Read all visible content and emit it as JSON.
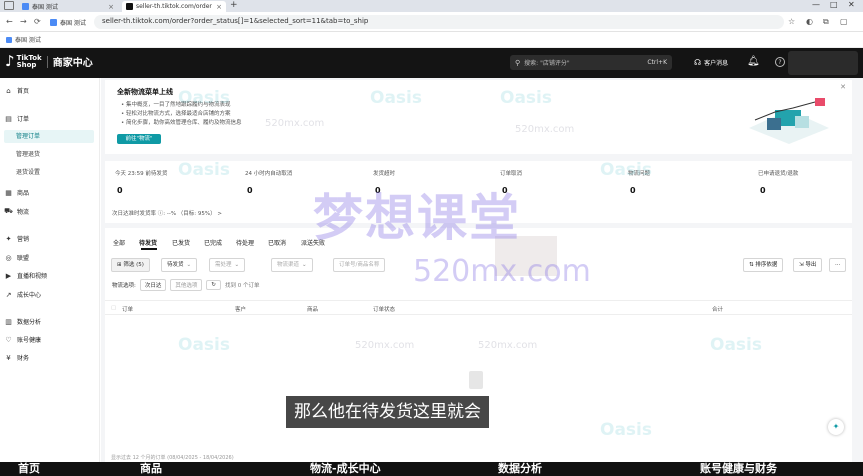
{
  "browser": {
    "tabs": [
      {
        "title": "泰国 测试",
        "color": "#4c8bf5"
      },
      {
        "title": "seller-th.tiktok.com/order",
        "color": "#111111"
      }
    ],
    "new_tab": "+",
    "window_controls": [
      "—",
      "□",
      "✕"
    ],
    "nav": {
      "back": "←",
      "forward": "→",
      "reload": "⟳"
    },
    "bookmark_chip": "泰国 测试",
    "url": "seller-th.tiktok.com/order?order_status[]=1&selected_sort=11&tab=to_ship",
    "toolbar_icons": [
      "☆",
      "◐",
      "⧉",
      "▢"
    ],
    "bookmarks": [
      {
        "label": "泰国 测试"
      }
    ]
  },
  "header": {
    "logo_note": "♪",
    "logo_line1": "TikTok",
    "logo_line2": "Shop",
    "center": "商家中心",
    "search_placeholder": "搜索: \"店铺评分\"",
    "search_shortcut": "Ctrl+K",
    "customer_service": "客户消息"
  },
  "sidebar": {
    "items": [
      {
        "icon": "⌂",
        "label": "首页"
      },
      {
        "icon": "▤",
        "label": "订单"
      },
      {
        "icon": "▦",
        "label": "商品"
      },
      {
        "icon": "⛟",
        "label": "物流"
      },
      {
        "icon": "✦",
        "label": "营销"
      },
      {
        "icon": "◎",
        "label": "联盟"
      },
      {
        "icon": "▶",
        "label": "直播和视频"
      },
      {
        "icon": "↗",
        "label": "成长中心"
      },
      {
        "icon": "▥",
        "label": "数据分析"
      },
      {
        "icon": "♡",
        "label": "账号健康"
      },
      {
        "icon": "¥",
        "label": "财务"
      }
    ],
    "order_sub": [
      "管理订单",
      "管理退货",
      "退货设置"
    ]
  },
  "banner": {
    "title": "全新物流菜单上线",
    "bullets": [
      "集中概览，一目了然地跟踪履约与物流表现",
      "轻松对比物流方式，选择最适合店铺的方案",
      "简化步骤，助你高效管理仓库、履约及物流信息"
    ],
    "cta": "前往\"物流\"",
    "close": "✕"
  },
  "stats": {
    "items": [
      {
        "label": "今天 23:59 前待发货",
        "value": "0"
      },
      {
        "label": "24 小时内自动取消",
        "value": "0"
      },
      {
        "label": "发货超时",
        "value": "0"
      },
      {
        "label": "订单取消",
        "value": "0"
      },
      {
        "label": "物流问题",
        "value": "0"
      },
      {
        "label": "已申请退货/退款",
        "value": "0"
      }
    ],
    "footer": "次日达准时发货率 ⓘ: --%  （目标: 95%）  >"
  },
  "orders": {
    "tabs": [
      "全部",
      "待发货",
      "已发货",
      "已完成",
      "待处理",
      "已取消",
      "派送失败"
    ],
    "filters": {
      "filter_btn": "⊞ 筛选 (5)",
      "to_ship": "待发货",
      "chip_a": "需处理",
      "chip_b": "物流渠道",
      "chip_c": "订单号/商品名称",
      "sort_btn": "⇅ 排序依据",
      "export_btn": "⇲ 导出",
      "more_btn": "···"
    },
    "row2": {
      "label": "物流选项:",
      "opt1": "次日达",
      "opt2": "其他选项",
      "refresh": "↻",
      "count": "找到 0 个订单"
    },
    "columns": [
      "订单",
      "客户",
      "商品",
      "订单状态",
      "合计"
    ],
    "footnote": "显示过去 12 个月的订单 (08/04/2025 - 18/04/2026)"
  },
  "overlay": {
    "watermark_cn": "梦想课堂",
    "watermark_url": "520mx.com",
    "watermark_small": "520mx.com",
    "watermark_logo": "Oasis",
    "subtitle": "那么他在待发货这里就会",
    "fab": "✦",
    "bottom_strip": [
      "首页",
      "商品",
      "物流-成长中心",
      "数据分析",
      "账号健康与财务"
    ]
  }
}
